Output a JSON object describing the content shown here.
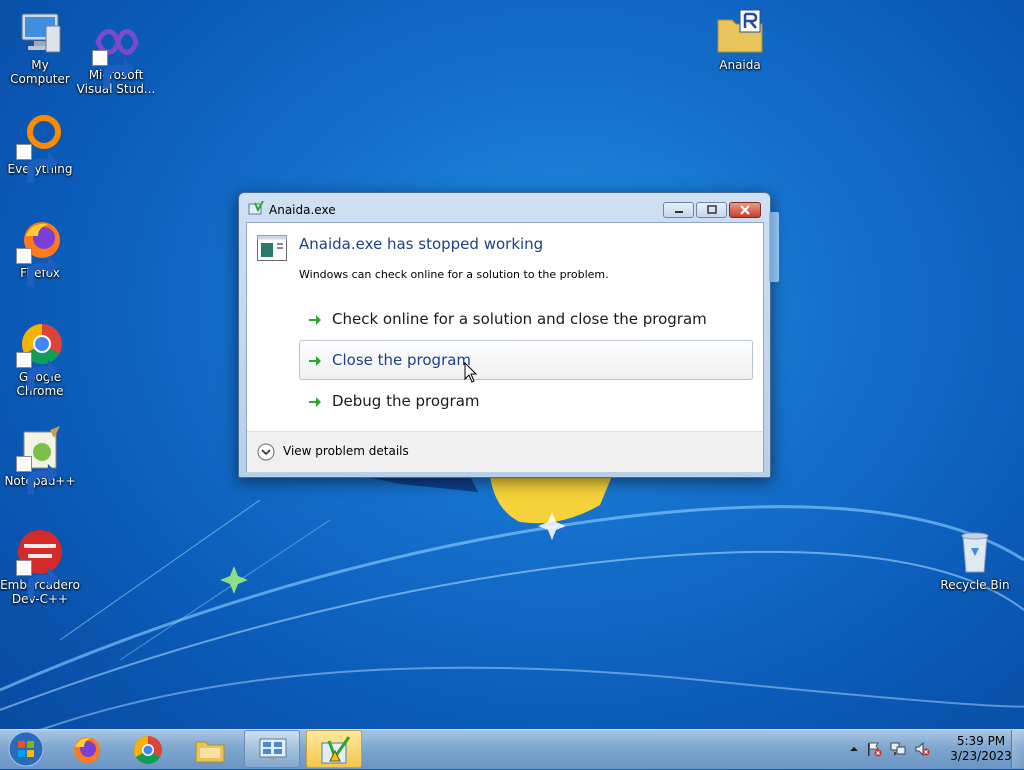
{
  "desktop": {
    "icons": [
      {
        "label": "My Computer"
      },
      {
        "label": "Microsoft Visual Stud..."
      },
      {
        "label": "Everything"
      },
      {
        "label": "Firefox"
      },
      {
        "label": "Google Chrome"
      },
      {
        "label": "Notepad++"
      },
      {
        "label": "Embarcadero Dev-C++"
      },
      {
        "label": "Anaida"
      },
      {
        "label": "Recycle Bin"
      }
    ]
  },
  "dialog": {
    "title": "Anaida.exe",
    "heading": "Anaida.exe has stopped working",
    "subtext": "Windows can check online for a solution to the problem.",
    "options": [
      {
        "label": "Check online for a solution and close the program"
      },
      {
        "label": "Close the program"
      },
      {
        "label": "Debug the program"
      }
    ],
    "details_label": "View problem details"
  },
  "taskbar": {
    "clock": {
      "time": "5:39 PM",
      "date": "3/23/2023"
    }
  },
  "colors": {
    "heading": "#1e3f8a",
    "desktop_bg": "#1470cc",
    "arrow_green": "#2aa82a"
  }
}
